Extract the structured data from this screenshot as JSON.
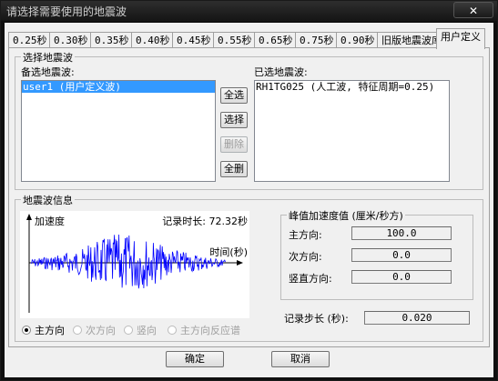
{
  "window": {
    "title": "请选择需要使用的地震波",
    "close_label": "✕"
  },
  "tabs": [
    "0.25秒",
    "0.30秒",
    "0.35秒",
    "0.40秒",
    "0.45秒",
    "0.55秒",
    "0.65秒",
    "0.75秒",
    "0.90秒",
    "旧版地震波库",
    "用户定义"
  ],
  "active_tab": "用户定义",
  "select_group": {
    "title": "选择地震波",
    "available_label": "备选地震波:",
    "available_items": [
      "user1 (用户定义波)"
    ],
    "selected_label": "已选地震波:",
    "selected_items": [
      "RH1TG025 (人工波, 特征周期=0.25)"
    ],
    "buttons": {
      "select_all": "全选",
      "select": "选择",
      "delete": "删除",
      "delete_all": "全删"
    }
  },
  "info_group": {
    "title": "地震波信息",
    "plot": {
      "y_label": "加速度",
      "duration_text": "记录时长: 72.32秒",
      "x_label": "时间(秒)"
    },
    "radio_options": [
      "主方向",
      "次方向",
      "竖向",
      "主方向反应谱"
    ],
    "radio_selected": "主方向",
    "peak_group_title": "峰值加速度值 (厘米/秒方)",
    "peak_rows": [
      {
        "label": "主方向:",
        "value": "100.0"
      },
      {
        "label": "次方向:",
        "value": "0.0"
      },
      {
        "label": "竖直方向:",
        "value": "0.0"
      }
    ],
    "step_label": "记录步长 (秒):",
    "step_value": "0.020"
  },
  "footer": {
    "ok": "确定",
    "cancel": "取消"
  },
  "colors": {
    "waveform": "#0000ff",
    "selection": "#3399ff"
  }
}
